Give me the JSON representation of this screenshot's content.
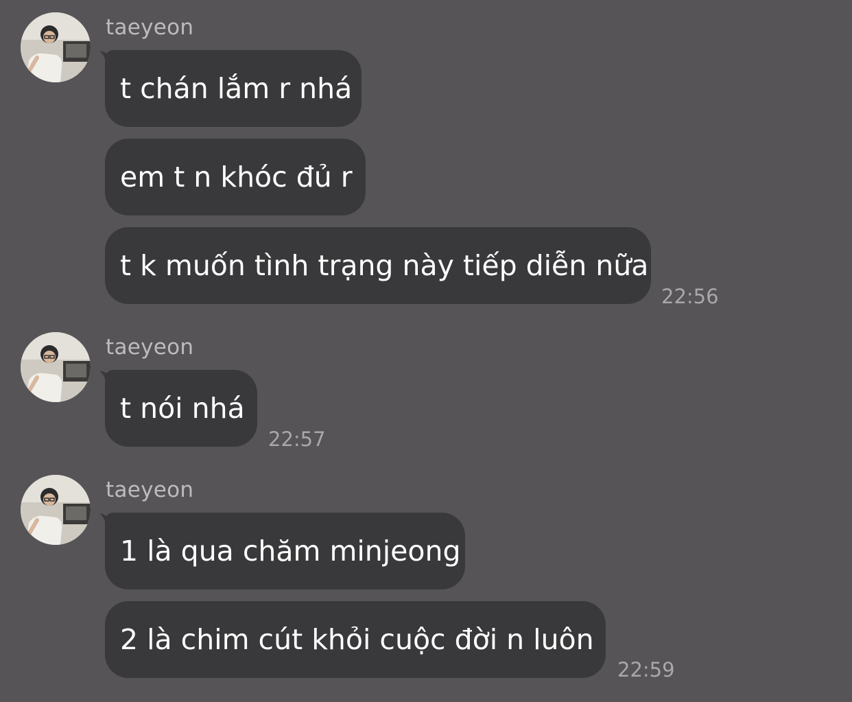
{
  "conversation": {
    "groups": [
      {
        "sender": "taeyeon",
        "avatar_icon": "profile-photo-icon",
        "messages": [
          "t chán lắm r nhá",
          "em t n khóc đủ r",
          "t k muốn tình trạng này tiếp diễn nữa"
        ],
        "time": "22:56"
      },
      {
        "sender": "taeyeon",
        "avatar_icon": "profile-photo-icon",
        "messages": [
          "t nói nhá"
        ],
        "time": "22:57"
      },
      {
        "sender": "taeyeon",
        "avatar_icon": "profile-photo-icon",
        "messages": [
          "1 là qua chăm minjeong",
          "2 là chim cút khỏi cuộc đời n luôn"
        ],
        "time": "22:59"
      }
    ]
  },
  "colors": {
    "background": "#565456",
    "bubble": "#39393b",
    "text": "#ffffff",
    "sender": "#bdbbbf",
    "time": "#a9a7ab"
  }
}
